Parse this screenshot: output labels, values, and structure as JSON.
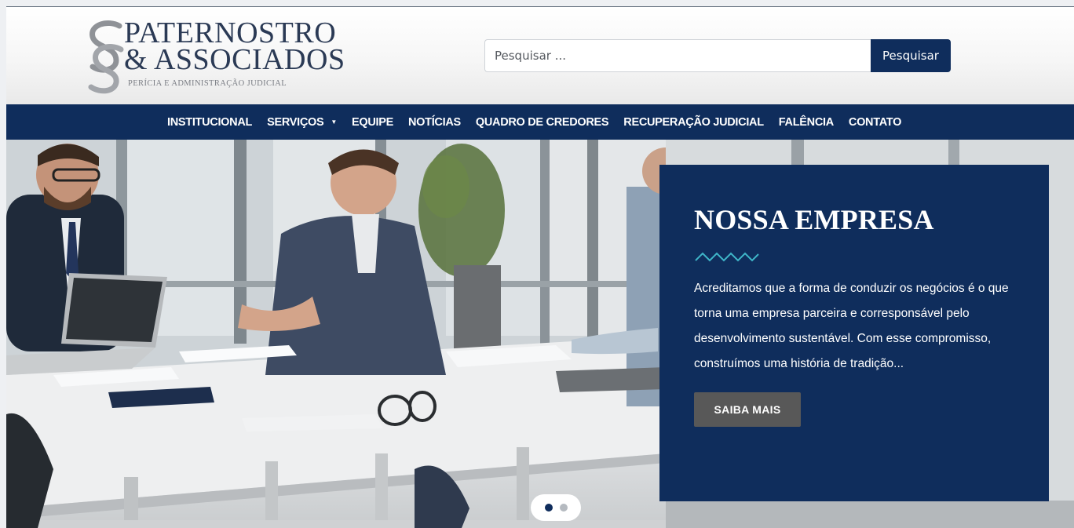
{
  "logo": {
    "line1": "PATERNOSTRO",
    "line2": "& ASSOCIADOS",
    "tagline": "PERÍCIA E ADMINISTRAÇÃO JUDICIAL",
    "mark_icon": "interlocked-s-monogram-icon"
  },
  "search": {
    "placeholder": "Pesquisar ...",
    "value": "",
    "button_label": "Pesquisar"
  },
  "nav": {
    "items": [
      {
        "label": "INSTITUCIONAL"
      },
      {
        "label": "SERVIÇOS",
        "has_dropdown": true,
        "caret": "▼"
      },
      {
        "label": "EQUIPE"
      },
      {
        "label": "NOTÍCIAS"
      },
      {
        "label": "QUADRO DE CREDORES"
      },
      {
        "label": "RECUPERAÇÃO JUDICIAL"
      },
      {
        "label": "FALÊNCIA"
      },
      {
        "label": "CONTATO"
      }
    ]
  },
  "hero": {
    "image": "office-meeting-photo",
    "title": "NOSSA EMPRESA",
    "wave_icon": "zigzag-divider-icon",
    "text": "Acreditamos que a forma de conduzir os negócios é o que torna uma empresa parceira e corresponsável pelo desenvolvimento sustentável. Com esse compromisso, construímos uma história de tradição...",
    "button_label": "SAIBA MAIS",
    "slides_total": 2,
    "slide_active": 1
  },
  "colors": {
    "brand_navy": "#0f2d5c",
    "button_gray": "#585858",
    "logo_text": "#2b3a55"
  }
}
